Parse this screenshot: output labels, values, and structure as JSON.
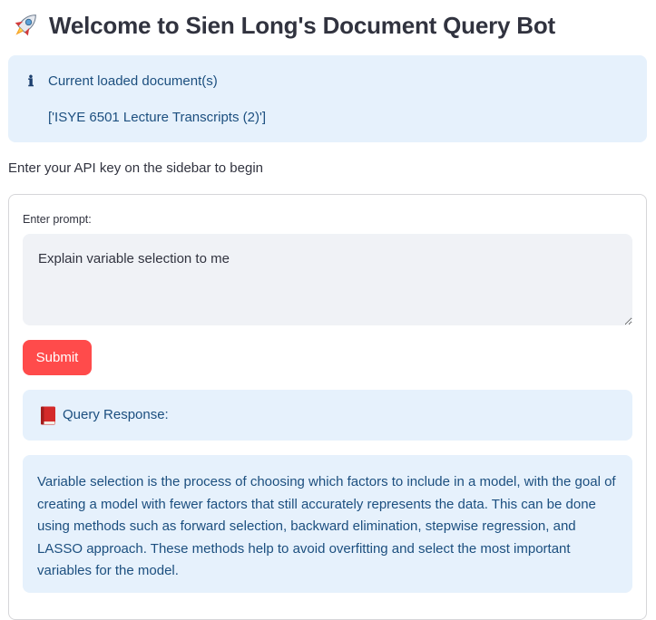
{
  "header": {
    "title": "Welcome to Sien Long's Document Query Bot",
    "icon": "rocket-icon"
  },
  "info": {
    "icon": "info-icon",
    "heading": "Current loaded document(s)",
    "documents": "['ISYE 6501 Lecture Transcripts (2)']"
  },
  "api_hint": "Enter your API key on the sidebar to begin",
  "form": {
    "prompt_label": "Enter prompt:",
    "prompt_value": "Explain variable selection to me",
    "submit_label": "Submit"
  },
  "response": {
    "icon": "book-icon",
    "header_label": "Query Response:",
    "text": "Variable selection is the process of choosing which factors to include in a model, with the goal of creating a model with fewer factors that still accurately represents the data. This can be done using methods such as forward selection, backward elimination, stepwise regression, and LASSO approach. These methods help to avoid overfitting and select the most important variables for the model."
  },
  "colors": {
    "accent": "#ff4b4b",
    "info_background": "#e6f1fc",
    "info_text": "#1c4f7f",
    "input_background": "#f0f2f6",
    "text": "#31333f"
  }
}
